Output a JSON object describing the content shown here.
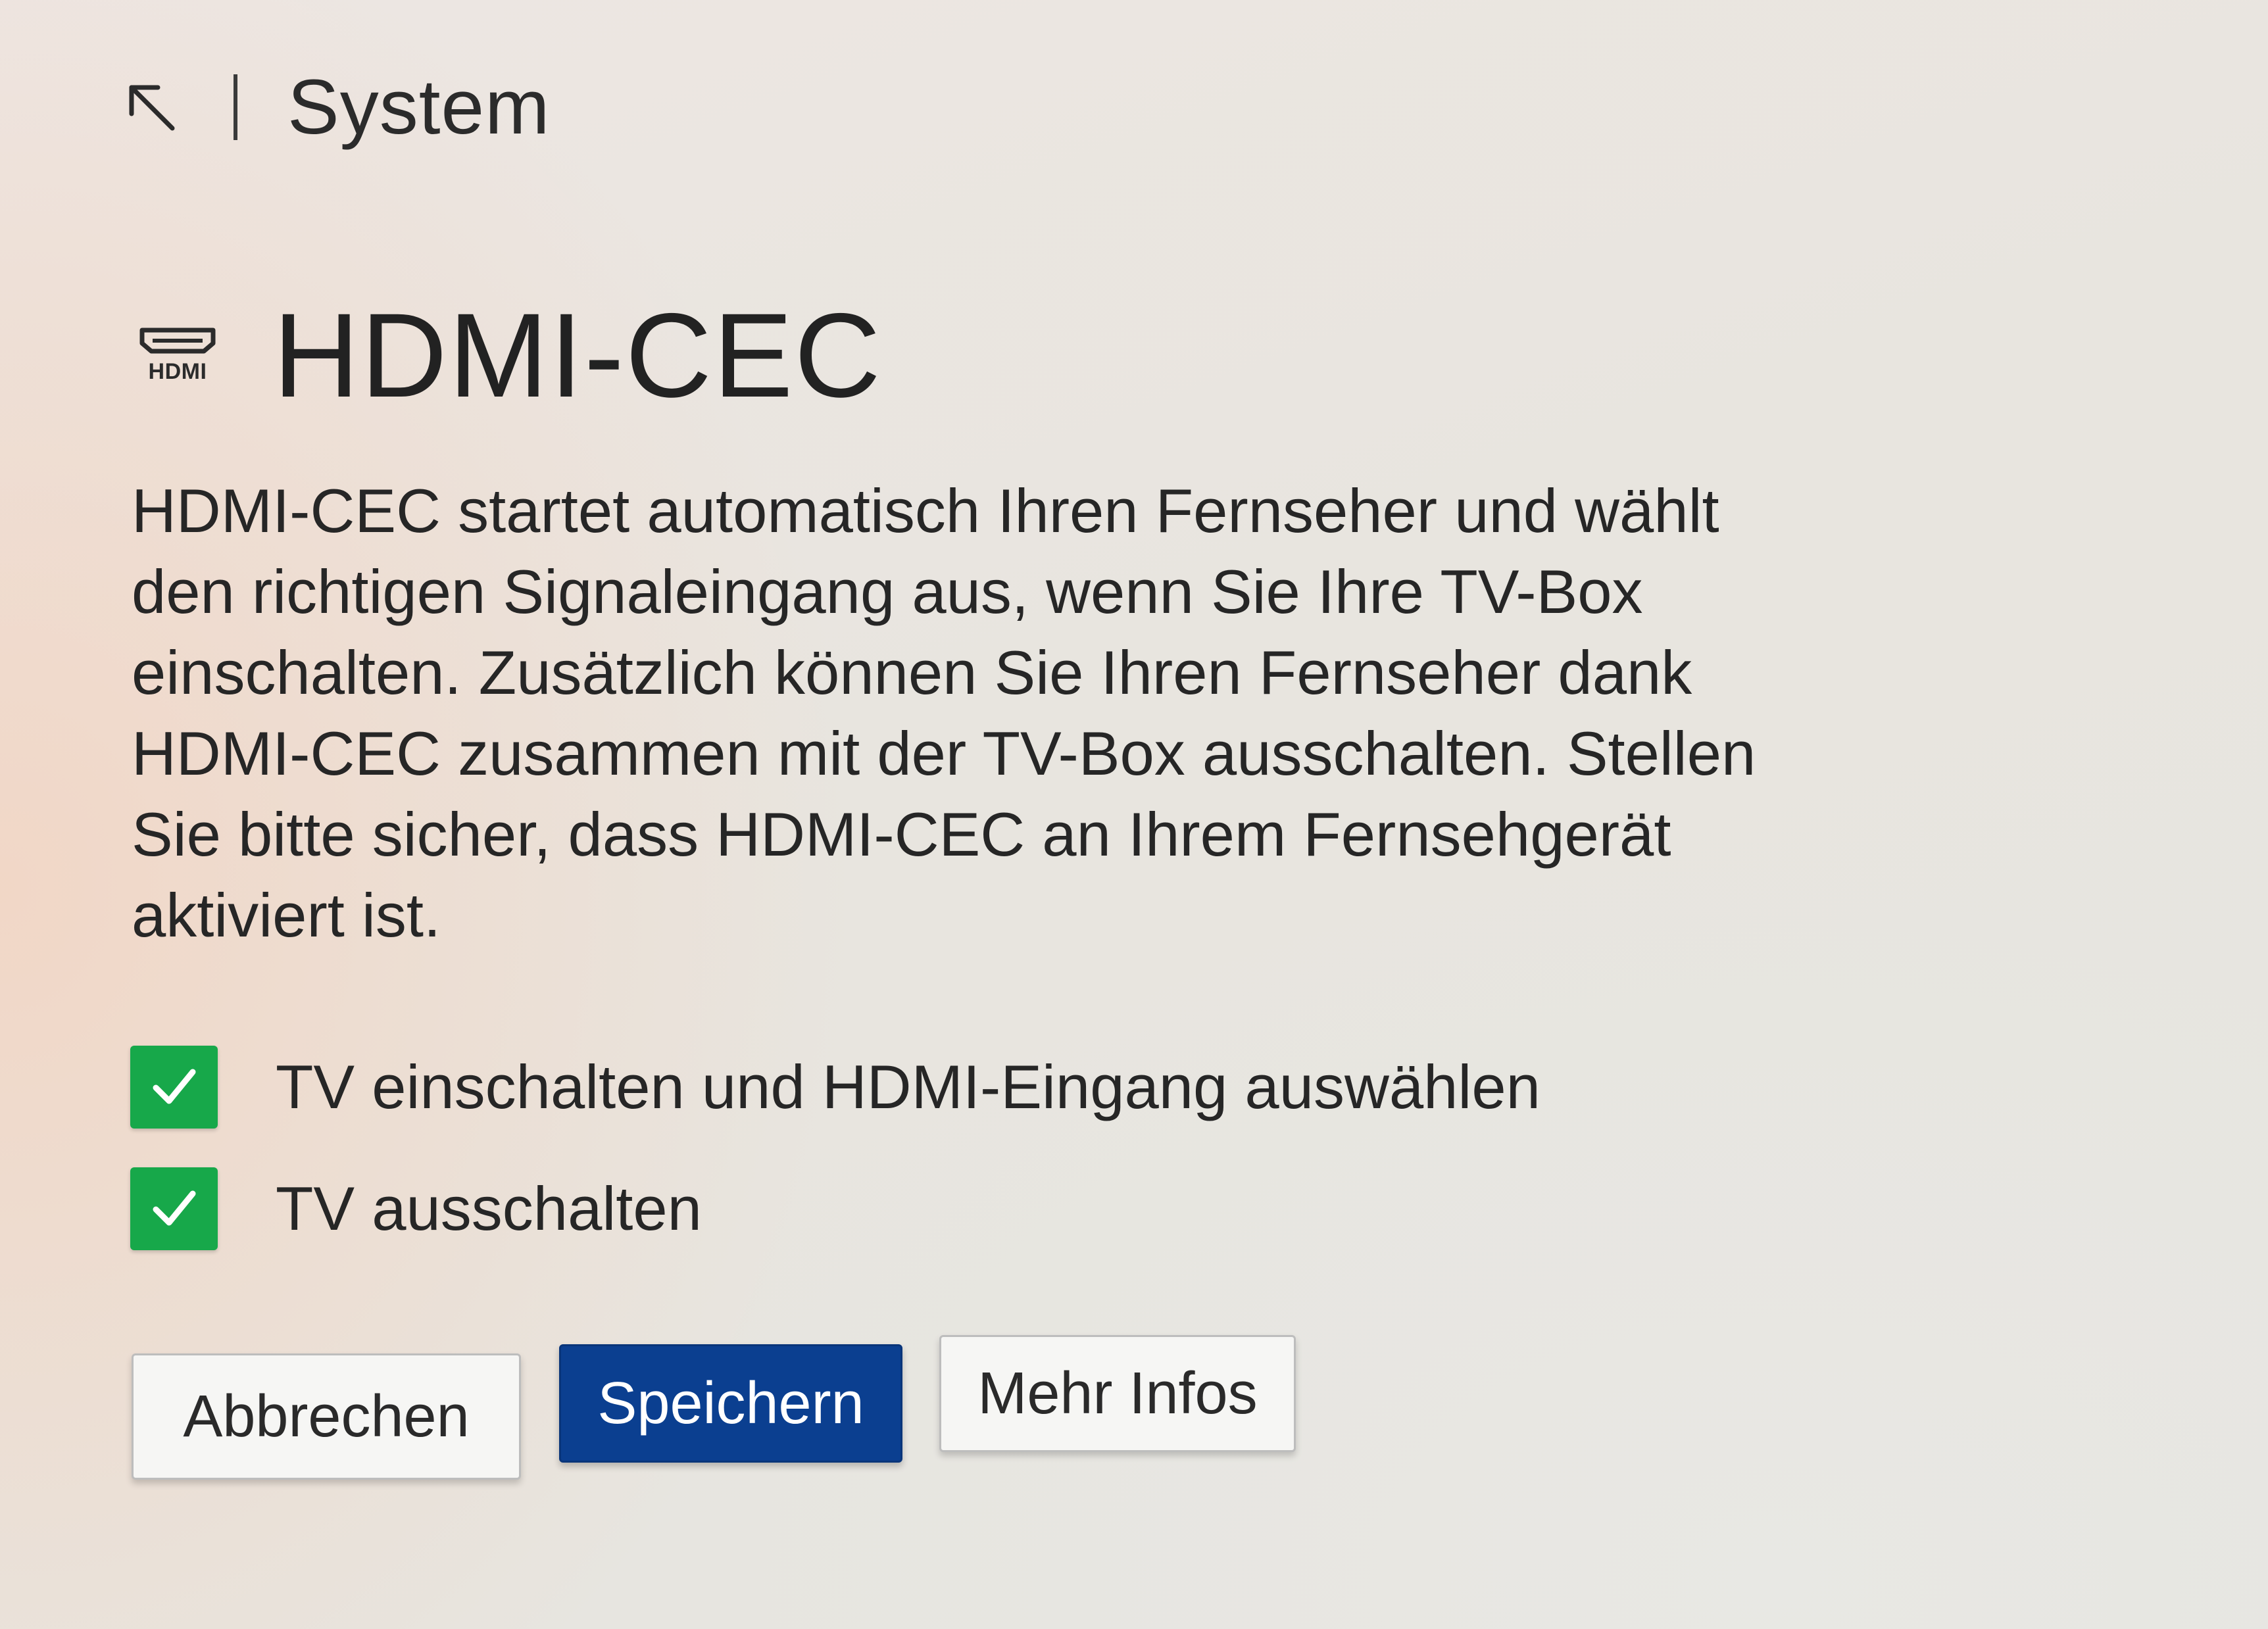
{
  "header": {
    "back_icon": "arrow-up-left-icon",
    "title": "System"
  },
  "main": {
    "icon": "hdmi-icon",
    "icon_text": "HDMI",
    "title": "HDMI-CEC",
    "description": "HDMI-CEC startet automatisch Ihren Fernseher und wählt den richtigen Signaleingang aus, wenn Sie Ihre TV-Box einschalten. Zusätzlich können Sie Ihren Fernseher dank HDMI-CEC zusammen mit der TV-Box ausschalten. Stellen Sie bitte sicher, dass HDMI-CEC an Ihrem Fernsehgerät aktiviert ist."
  },
  "options": [
    {
      "label": "TV einschalten und HDMI-Eingang auswählen",
      "checked": true
    },
    {
      "label": "TV ausschalten",
      "checked": true
    }
  ],
  "buttons": {
    "cancel_label": "Abbrechen",
    "save_label": "Speichern",
    "more_label": "Mehr Infos"
  },
  "colors": {
    "checkbox": "#17a84a",
    "primary_button": "#0b3f90",
    "text": "#262626"
  }
}
